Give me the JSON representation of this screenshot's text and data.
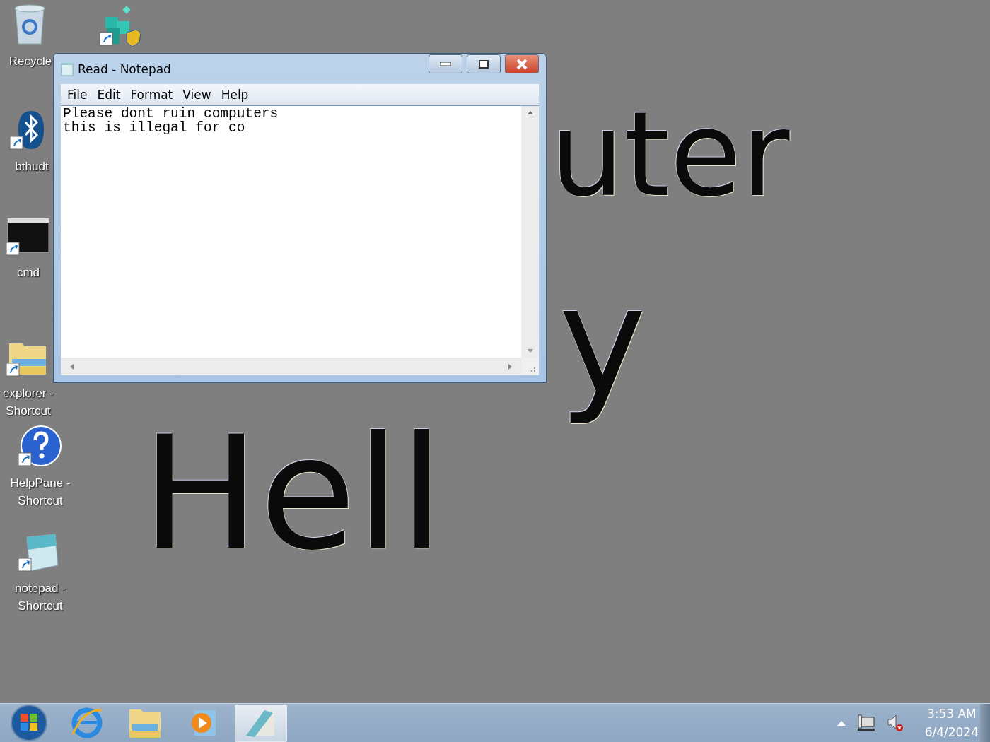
{
  "desktop": {
    "icons": [
      {
        "kind": "recycle",
        "label": "Recycle",
        "shortcut": false
      },
      {
        "kind": "registry",
        "shortcut": true
      },
      {
        "kind": "bluetooth",
        "label": "bthudt",
        "shortcut": true
      },
      {
        "kind": "console",
        "label": "cmd",
        "shortcut": true
      },
      {
        "kind": "folder",
        "label": "explorer - Shortcut",
        "shortcut": true
      },
      {
        "kind": "help",
        "label": "HelpPane - Shortcut",
        "shortcut": true
      },
      {
        "kind": "notepad",
        "label": "notepad - Shortcut",
        "shortcut": true
      }
    ],
    "wallpaper_text": [
      "uter",
      "y",
      "Hell"
    ]
  },
  "window": {
    "title": "Read - Notepad",
    "menu": [
      "File",
      "Edit",
      "Format",
      "View",
      "Help"
    ],
    "lines": [
      "Please dont ruin computers",
      "this is illegal for co"
    ]
  },
  "taskbar": {
    "apps": [
      {
        "kind": "start",
        "selected": false
      },
      {
        "kind": "browser",
        "selected": false
      },
      {
        "kind": "folder",
        "selected": false
      },
      {
        "kind": "media",
        "selected": false
      },
      {
        "kind": "notepad",
        "selected": true
      }
    ],
    "clock": {
      "time": "3:53 AM",
      "date": "6/4/2024"
    }
  }
}
